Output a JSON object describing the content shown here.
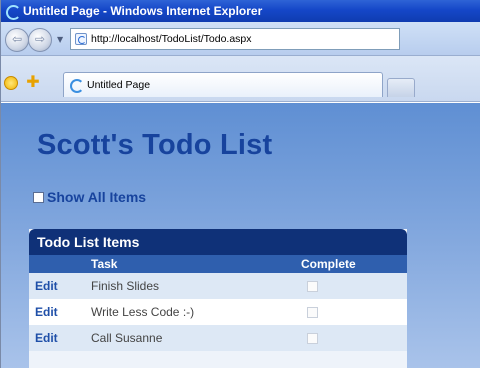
{
  "window": {
    "title": "Untitled Page - Windows Internet Explorer",
    "icon": "ie-icon"
  },
  "address": {
    "back_icon": "back-icon",
    "forward_icon": "forward-icon",
    "url": "http://localhost/TodoList/Todo.aspx"
  },
  "tabs": {
    "active_label": "Untitled Page"
  },
  "page": {
    "title": "Scott's Todo List",
    "show_all_label": "Show All Items",
    "show_all_checked": false
  },
  "grid": {
    "caption": "Todo List Items",
    "columns": [
      "",
      "Task",
      "Complete"
    ],
    "rows": [
      {
        "action": "Edit",
        "task": "Finish Slides",
        "complete": false
      },
      {
        "action": "Edit",
        "task": "Write Less Code :-)",
        "complete": false
      },
      {
        "action": "Edit",
        "task": "Call Susanne",
        "complete": false
      }
    ]
  },
  "colors": {
    "title_blue": "#17439d",
    "caption_bg": "#0f3178",
    "header_bg": "#2f5fae",
    "content_gradient_top": "#5f8fd3"
  }
}
